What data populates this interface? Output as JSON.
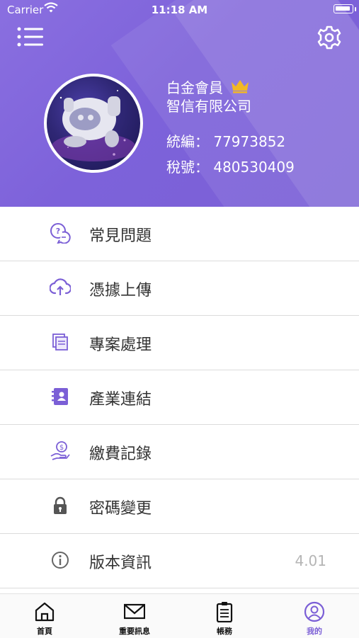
{
  "status_bar": {
    "carrier": "Carrier",
    "time": "11:18 AM"
  },
  "profile": {
    "tier": "白金會員",
    "company": "智信有限公司",
    "tax_id_label": "統編：",
    "tax_id": "77973852",
    "tax_no_label": "稅號：",
    "tax_no": "480530409"
  },
  "menu": [
    {
      "label": "常見問題",
      "icon": "faq-chat-icon"
    },
    {
      "label": "憑據上傳",
      "icon": "cloud-upload-icon"
    },
    {
      "label": "專案處理",
      "icon": "documents-icon"
    },
    {
      "label": "產業連結",
      "icon": "contact-book-icon"
    },
    {
      "label": "繳費記錄",
      "icon": "payment-hand-icon"
    },
    {
      "label": "密碼變更",
      "icon": "lock-icon"
    },
    {
      "label": "版本資訊",
      "icon": "info-icon",
      "value": "4.01"
    }
  ],
  "tabs": [
    {
      "label": "首頁",
      "icon": "home-icon",
      "active": false
    },
    {
      "label": "重要訊息",
      "icon": "envelope-icon",
      "active": false
    },
    {
      "label": "帳務",
      "icon": "clipboard-icon",
      "active": false
    },
    {
      "label": "我的",
      "icon": "user-circle-icon",
      "active": true
    }
  ],
  "colors": {
    "accent": "#7b5fd6",
    "header": "#8068dd",
    "icon": "#7b5fd6",
    "gold": "#f2b824"
  }
}
